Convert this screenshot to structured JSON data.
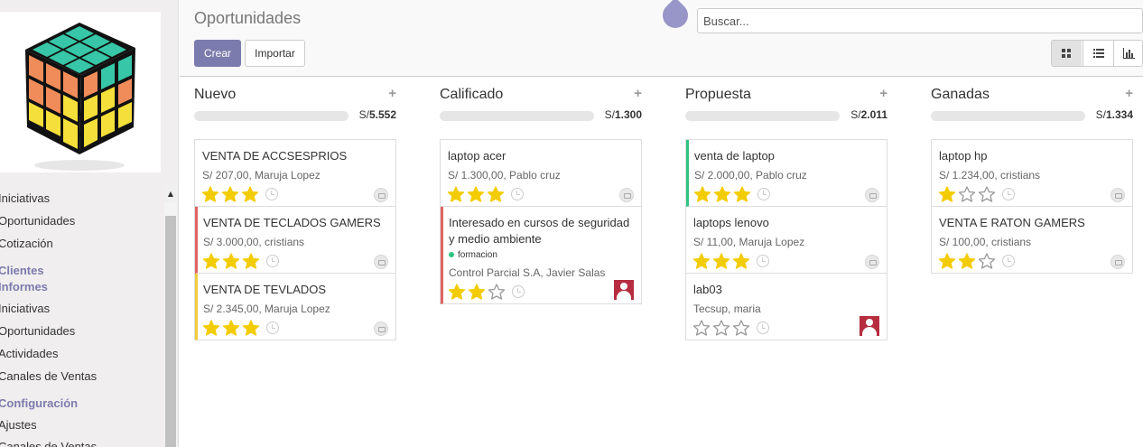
{
  "app": {
    "colors": {
      "accent": "#7c7bad",
      "star_on": "#f3cc00",
      "star_off": "#999999",
      "red": "#e06464",
      "yellow": "#f0cc3d",
      "green": "#30c381"
    }
  },
  "sidebar": {
    "logo": "rubiks-cube-logo",
    "items": [
      {
        "label": "Iniciativas",
        "type": "item"
      },
      {
        "label": "Oportunidades",
        "type": "item"
      },
      {
        "label": "Cotización",
        "type": "item"
      },
      {
        "label": "Clientes",
        "type": "head"
      },
      {
        "label": "Informes",
        "type": "head"
      },
      {
        "label": "Iniciativas",
        "type": "item"
      },
      {
        "label": "Oportunidades",
        "type": "item"
      },
      {
        "label": "Actividades",
        "type": "item"
      },
      {
        "label": "Canales de Ventas",
        "type": "item"
      },
      {
        "label": "Configuración",
        "type": "head"
      },
      {
        "label": "Ajustes",
        "type": "item"
      },
      {
        "label": "Canales de Ventas",
        "type": "item"
      }
    ]
  },
  "header": {
    "breadcrumb": "Oportunidades",
    "create_label": "Crear",
    "import_label": "Importar",
    "search_placeholder": "Buscar...",
    "view_switcher": [
      "kanban-view-icon",
      "list-view-icon",
      "graph-view-icon"
    ],
    "active_view": "kanban"
  },
  "columns": [
    {
      "title": "Nuevo",
      "currency": "S/",
      "total": "5.552",
      "cards": [
        {
          "title": "VENTA DE ACCSESPRIOS",
          "subtitle": "S/ 207,00, Maruja Lopez",
          "stars": 3,
          "color": "none",
          "tag": "",
          "avatar": false
        },
        {
          "title": "VENTA DE TECLADOS GAMERS",
          "subtitle": "S/ 3.000,00, cristians",
          "stars": 3,
          "color": "red",
          "tag": "",
          "avatar": false
        },
        {
          "title": "VENTA DE TEVLADOS",
          "subtitle": "S/ 2.345,00, Maruja Lopez",
          "stars": 3,
          "color": "yellow",
          "tag": "",
          "avatar": false
        }
      ]
    },
    {
      "title": "Calificado",
      "currency": "S/",
      "total": "1.300",
      "cards": [
        {
          "title": "laptop acer",
          "subtitle": "S/ 1.300,00, Pablo cruz",
          "stars": 3,
          "color": "none",
          "tag": "",
          "avatar": false
        },
        {
          "title": "Interesado en cursos de seguridad y medio ambiente",
          "subtitle": "Control Parcial S.A, Javier Salas",
          "stars": 2,
          "color": "red",
          "tag": "formacion",
          "avatar": true
        }
      ]
    },
    {
      "title": "Propuesta",
      "currency": "S/",
      "total": "2.011",
      "cards": [
        {
          "title": "venta de laptop",
          "subtitle": "S/ 2.000,00, Pablo cruz",
          "stars": 3,
          "color": "green",
          "tag": "",
          "avatar": false
        },
        {
          "title": "laptops lenovo",
          "subtitle": "S/ 11,00, Maruja Lopez",
          "stars": 3,
          "color": "none",
          "tag": "",
          "avatar": false
        },
        {
          "title": "lab03",
          "subtitle": "Tecsup, maria",
          "stars": 0,
          "color": "none",
          "tag": "",
          "avatar": true
        }
      ]
    },
    {
      "title": "Ganadas",
      "currency": "S/",
      "total": "1.334",
      "cards": [
        {
          "title": "laptop hp",
          "subtitle": "S/ 1.234,00, cristians",
          "stars": 1,
          "color": "none",
          "tag": "",
          "avatar": false
        },
        {
          "title": "VENTA E RATON GAMERS",
          "subtitle": "S/ 100,00, cristians",
          "stars": 2,
          "color": "none",
          "tag": "",
          "avatar": false
        }
      ]
    }
  ]
}
